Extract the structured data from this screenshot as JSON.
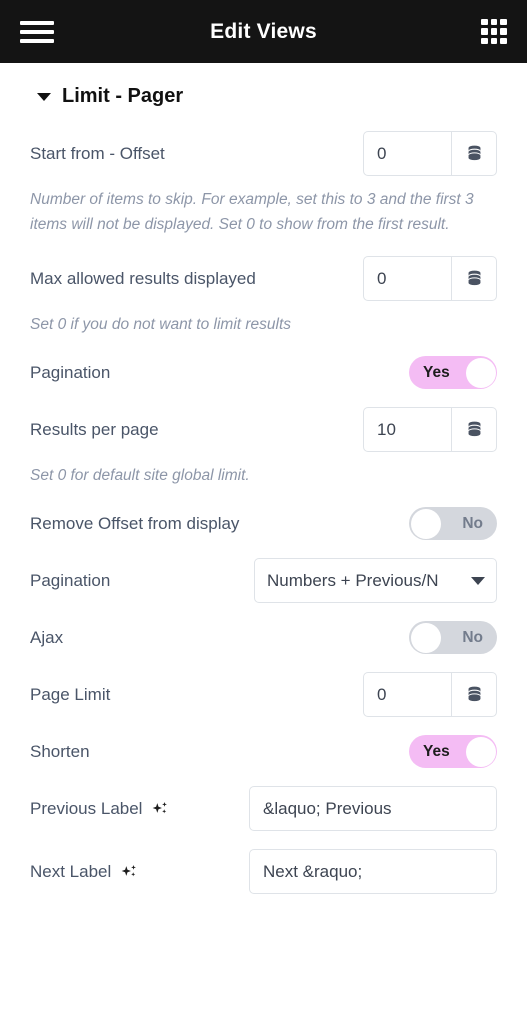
{
  "header": {
    "title": "Edit Views",
    "menu_icon": "hamburger-icon",
    "grid_icon": "apps-grid-icon"
  },
  "section": {
    "title": "Limit - Pager",
    "expanded": true
  },
  "theme": {
    "topbar_bg": "#141414",
    "toggle_on": "#f4bcf4",
    "toggle_off": "#d4d7dd",
    "label_color": "#4a5568",
    "help_color": "#8d96a8",
    "border_color": "#dfe3e8"
  },
  "fields": {
    "offset": {
      "label": "Start from - Offset",
      "value": "0",
      "help": "Number of items to skip. For example, set this to 3 and the first 3 items will not be displayed. Set 0 to show from the first result."
    },
    "max_results": {
      "label": "Max allowed results displayed",
      "value": "0",
      "help": "Set 0 if you do not want to limit results"
    },
    "pagination_toggle": {
      "label": "Pagination",
      "state": "Yes"
    },
    "results_per_page": {
      "label": "Results per page",
      "value": "10",
      "help": "Set 0 for default site global limit."
    },
    "remove_offset": {
      "label": "Remove Offset from display",
      "state": "No"
    },
    "pagination_type": {
      "label": "Pagination",
      "value": "Numbers + Previous/N"
    },
    "ajax": {
      "label": "Ajax",
      "state": "No"
    },
    "page_limit": {
      "label": "Page Limit",
      "value": "0"
    },
    "shorten": {
      "label": "Shorten",
      "state": "Yes"
    },
    "previous_label": {
      "label": "Previous Label",
      "value": "&laquo; Previous"
    },
    "next_label": {
      "label": "Next Label",
      "value": "Next &raquo;"
    }
  }
}
